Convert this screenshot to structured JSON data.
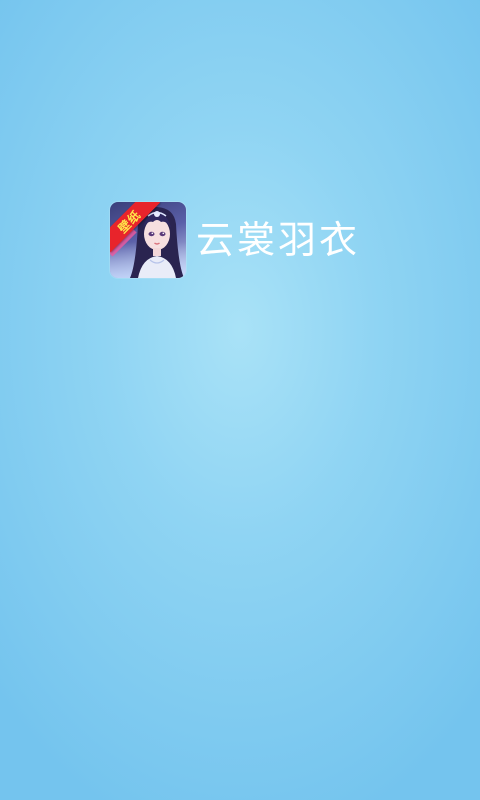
{
  "splash": {
    "app_name": "云裳羽衣",
    "icon_badge": "壁纸",
    "icon_name": "app-logo-icon"
  },
  "colors": {
    "background_center": "#a9e2f7",
    "background_edge": "#74c4ee",
    "title_text": "#ffffff",
    "badge_red": "#e8242b",
    "badge_text": "#ffe84a"
  }
}
